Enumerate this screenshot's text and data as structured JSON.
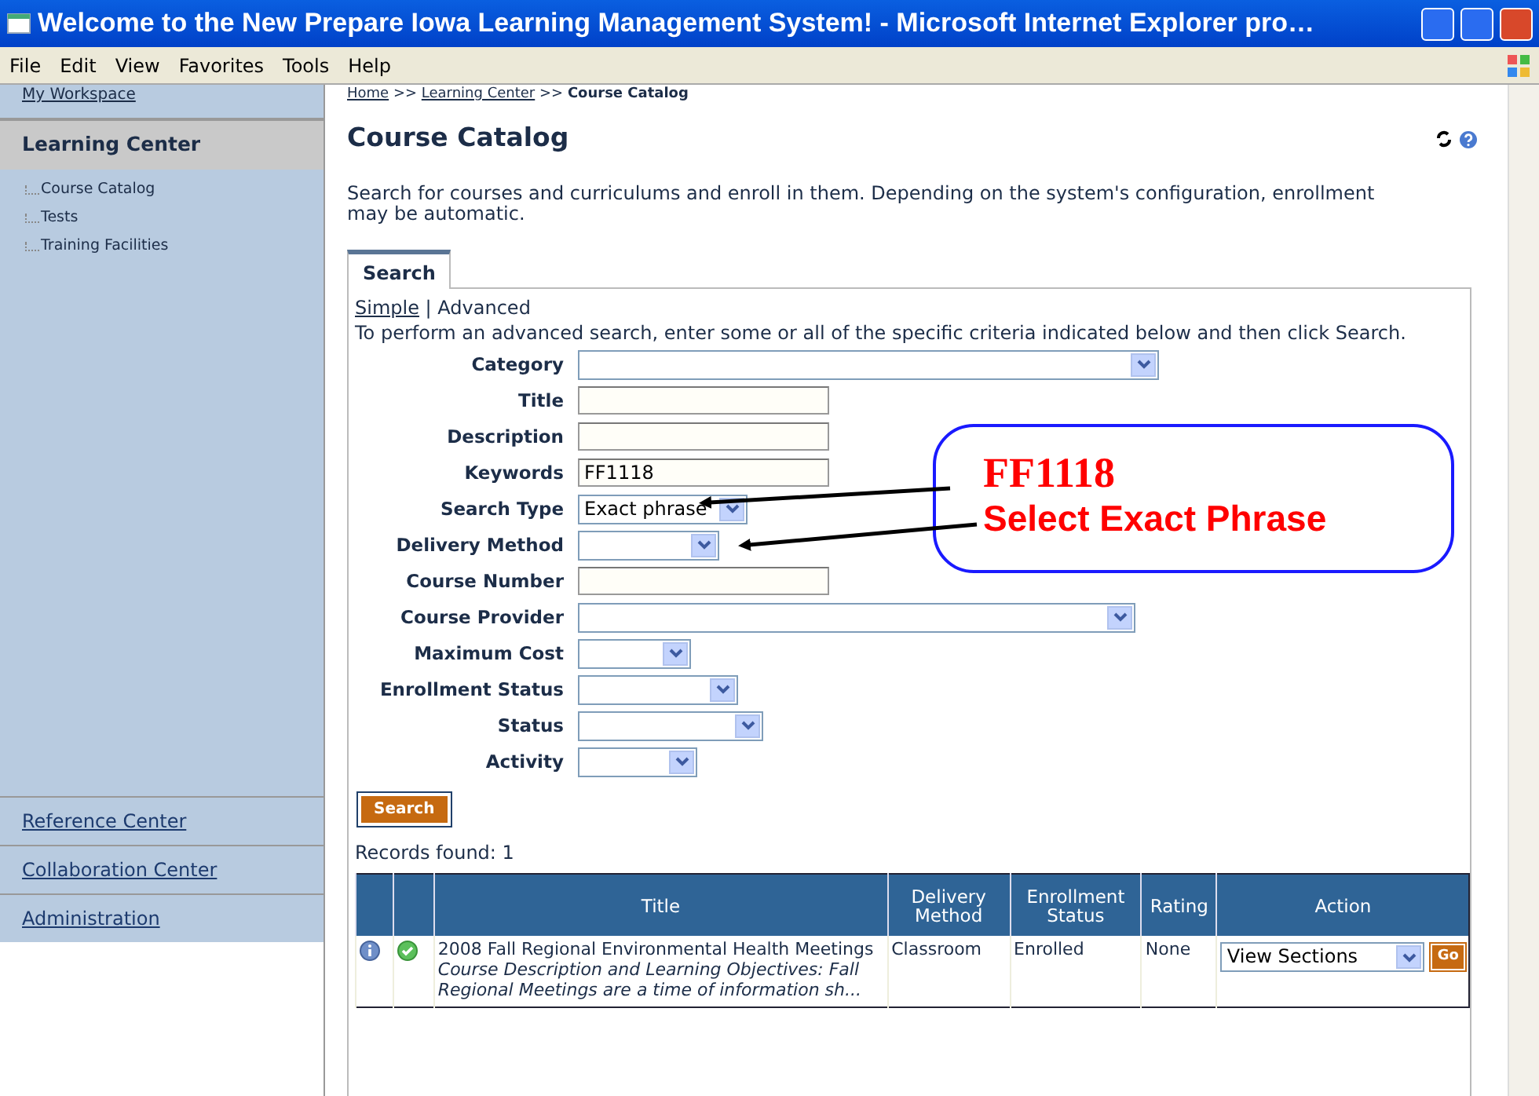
{
  "window": {
    "title": "Welcome to the New Prepare Iowa Learning Management System! - Microsoft Internet Explorer pro…"
  },
  "menu": [
    "File",
    "Edit",
    "View",
    "Favorites",
    "Tools",
    "Help"
  ],
  "sidebar": {
    "top_link": "My Workspace",
    "section": "Learning Center",
    "items": [
      "Course Catalog",
      "Tests",
      "Training Facilities"
    ],
    "bottom_links": [
      "Reference Center",
      "Collaboration Center",
      "Administration"
    ]
  },
  "breadcrumb": {
    "links": [
      "Home",
      "Learning Center"
    ],
    "current": "Course Catalog",
    "separator": ">>"
  },
  "page": {
    "title": "Course Catalog",
    "intro": "Search for courses and curriculums and enroll in them. Depending on the system's configuration, enrollment may be automatic."
  },
  "tabs": [
    {
      "label": "Search",
      "selected": true
    }
  ],
  "search_modes": [
    {
      "label": "Simple",
      "selected": false
    },
    {
      "label": "Advanced",
      "selected": true
    }
  ],
  "mode_separator": "|",
  "instructions": "To perform an advanced search, enter some or all of the specific criteria indicated below and then click Search.",
  "fields": [
    {
      "label": "Category",
      "kind": "select"
    },
    {
      "label": "Title",
      "kind": "text"
    },
    {
      "label": "Description",
      "kind": "text"
    },
    {
      "label": "Keywords",
      "kind": "text",
      "value": "FF1118"
    },
    {
      "label": "Search Type",
      "kind": "select",
      "value": "Exact phrase"
    },
    {
      "label": "Delivery Method",
      "kind": "select"
    },
    {
      "label": "Course Number",
      "kind": "text"
    },
    {
      "label": "Course Provider",
      "kind": "select"
    },
    {
      "label": "Maximum Cost",
      "kind": "select"
    },
    {
      "label": "Enrollment Status",
      "kind": "select"
    },
    {
      "label": "Status",
      "kind": "select"
    },
    {
      "label": "Activity",
      "kind": "select"
    }
  ],
  "search_button": "Search",
  "records_found": "Records found: 1",
  "table": {
    "columns": [
      "Title",
      "Delivery Method",
      "Enrollment Status",
      "Rating",
      "Action"
    ],
    "rows": [
      {
        "title": "2008 Fall Regional Environmental Health Meetings",
        "description": "Course Description and Learning Objectives: Fall Regional Meetings are a time of information sh...",
        "delivery_method": "Classroom",
        "enrollment_status": "Enrolled",
        "rating": "None",
        "action": "View Sections",
        "go": "Go"
      }
    ]
  },
  "annotation": {
    "lines": [
      "FF1118",
      "Select Exact Phrase"
    ]
  }
}
